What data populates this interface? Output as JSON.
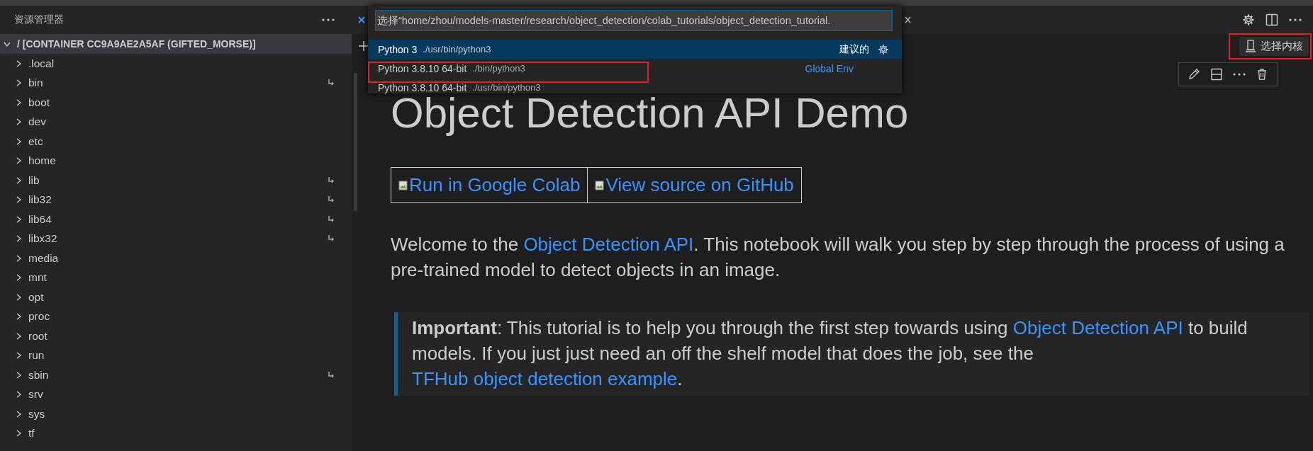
{
  "sidebar": {
    "title": "资源管理器",
    "root": {
      "label": "/ [CONTAINER CC9A9AE2A5AF (GIFTED_MORSE)]",
      "expanded": true,
      "children": [
        {
          "label": ".local",
          "expanded": false,
          "symlink": false
        },
        {
          "label": "bin",
          "expanded": false,
          "symlink": true
        },
        {
          "label": "boot",
          "expanded": false,
          "symlink": false
        },
        {
          "label": "dev",
          "expanded": false,
          "symlink": false
        },
        {
          "label": "etc",
          "expanded": false,
          "symlink": false
        },
        {
          "label": "home",
          "expanded": false,
          "symlink": false
        },
        {
          "label": "lib",
          "expanded": false,
          "symlink": true
        },
        {
          "label": "lib32",
          "expanded": false,
          "symlink": true
        },
        {
          "label": "lib64",
          "expanded": false,
          "symlink": true
        },
        {
          "label": "libx32",
          "expanded": false,
          "symlink": true
        },
        {
          "label": "media",
          "expanded": false,
          "symlink": false
        },
        {
          "label": "mnt",
          "expanded": false,
          "symlink": false
        },
        {
          "label": "opt",
          "expanded": false,
          "symlink": false
        },
        {
          "label": "proc",
          "expanded": false,
          "symlink": false
        },
        {
          "label": "root",
          "expanded": false,
          "symlink": false
        },
        {
          "label": "run",
          "expanded": false,
          "symlink": false
        },
        {
          "label": "sbin",
          "expanded": false,
          "symlink": true
        },
        {
          "label": "srv",
          "expanded": false,
          "symlink": false
        },
        {
          "label": "sys",
          "expanded": false,
          "symlink": false
        },
        {
          "label": "tf",
          "expanded": false,
          "symlink": false
        }
      ]
    }
  },
  "quick_pick": {
    "placeholder": "选择“home/zhou/models-master/research/object_detection/colab_tutorials/object_detection_tutorial.",
    "items": [
      {
        "label": "Python 3",
        "detail": "./usr/bin/python3",
        "description": "建议的",
        "selected": true,
        "highlighted": false
      },
      {
        "label": "Python 3.8.10 64-bit",
        "detail": "./bin/python3",
        "description": "Global Env",
        "selected": false,
        "highlighted": true
      },
      {
        "label": "Python 3.8.10 64-bit",
        "detail": "./usr/bin/python3",
        "selected": false,
        "highlighted": false
      }
    ]
  },
  "kernel_button": {
    "label": "选择内核",
    "highlighted": true
  },
  "notebook": {
    "heading": "Object Detection API Demo",
    "badges": [
      "Run in Google Colab",
      "View source on GitHub"
    ],
    "paragraph": [
      {
        "kind": "text",
        "text": "Welcome to the "
      },
      {
        "kind": "link",
        "text": "Object Detection API"
      },
      {
        "kind": "text",
        "text": ". This notebook will walk you step by step through the process of using a pre-trained model to detect objects in an image."
      }
    ],
    "note": [
      {
        "kind": "bold",
        "text": "Important"
      },
      {
        "kind": "text",
        "text": ": This tutorial is to help you through the first step towards using "
      },
      {
        "kind": "link",
        "text": "Object Detection API"
      },
      {
        "kind": "text",
        "text": " to build models. If you just just need an off the shelf model that does the job, see the "
      },
      {
        "kind": "link",
        "text": "TFHub object detection example"
      },
      {
        "kind": "text",
        "text": "."
      }
    ]
  }
}
